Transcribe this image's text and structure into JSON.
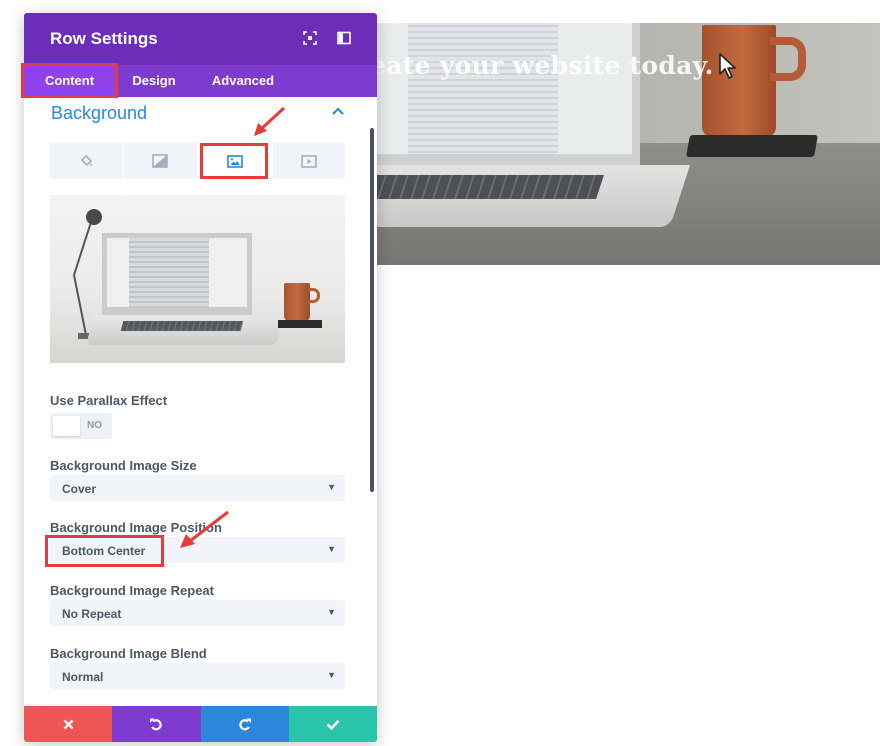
{
  "hero": {
    "headline": "eate your website today."
  },
  "modal": {
    "title": "Row Settings",
    "tabs": [
      {
        "label": "Content",
        "active": true
      },
      {
        "label": "Design",
        "active": false
      },
      {
        "label": "Advanced",
        "active": false
      }
    ],
    "section_title": "Background",
    "background_tabs": [
      {
        "icon": "paint-bucket-icon",
        "active": false
      },
      {
        "icon": "gradient-icon",
        "active": false
      },
      {
        "icon": "image-icon",
        "active": true
      },
      {
        "icon": "video-icon",
        "active": false
      }
    ],
    "fields": {
      "parallax": {
        "label": "Use Parallax Effect",
        "value": "NO"
      },
      "size": {
        "label": "Background Image Size",
        "value": "Cover"
      },
      "position": {
        "label": "Background Image Position",
        "value": "Bottom Center"
      },
      "repeat": {
        "label": "Background Image Repeat",
        "value": "No Repeat"
      },
      "blend": {
        "label": "Background Image Blend",
        "value": "Normal"
      }
    },
    "footer_buttons": [
      {
        "icon": "close-icon",
        "color": "#ef5555"
      },
      {
        "icon": "undo-icon",
        "color": "#7e3bd0"
      },
      {
        "icon": "redo-icon",
        "color": "#2b87da"
      },
      {
        "icon": "check-icon",
        "color": "#29c4a9"
      }
    ]
  },
  "colors": {
    "header": "#6c2eb9",
    "tabs": "#7e3bd0",
    "accent": "#2b87da",
    "annotation": "#e93b3b"
  }
}
